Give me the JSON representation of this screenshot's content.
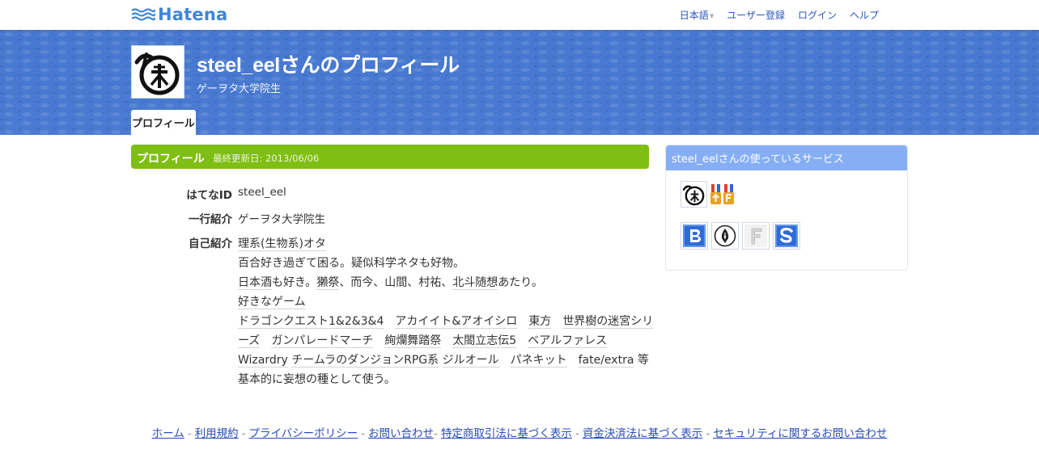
{
  "header": {
    "logo_text": "Hatena",
    "nav": {
      "language": "日本語",
      "register": "ユーザー登録",
      "login": "ログイン",
      "help": "ヘルプ"
    }
  },
  "profile": {
    "title": "steel_eelさんのプロフィール",
    "subtitle": "ゲーヲタ大学院生",
    "tab": "プロフィール"
  },
  "section": {
    "title": "プロフィール",
    "updated": "最終更新日: 2013/06/06"
  },
  "fields": {
    "id_label": "はてなID",
    "id_value": "steel_eel",
    "oneline_label": "一行紹介",
    "oneline_value": "ゲーヲタ大学院生",
    "intro_label": "自己紹介"
  },
  "intro": {
    "l1": "理系(生物系)オタ",
    "l2": "百合好き過ぎて困る。疑似科学ネタも好物。",
    "l3a": "日本酒",
    "l3b": "も好き。",
    "l3c": "獺祭",
    "l3d": "、而今、山間、村祐、",
    "l3e": "北斗随想",
    "l3f": "あたり。",
    "l4": "好きなゲーム",
    "games": {
      "dq": "ドラゴンクエスト1&2&3&4",
      "ac": "アカイイト&アオイシロ",
      "th": "東方",
      "eo1": "世界樹の迷宮シリ",
      "eo2": "ーズ",
      "gpm": "ガンパレードマーチ",
      "kr": "絢爛舞踏祭",
      "tk": "太閤立志伝5",
      "bf": "ベアルファレス",
      "wiz": "Wizardry",
      "chm": "チームラのダンジョンRPG系",
      "jo": "ジルオール",
      "pk": "パネキット",
      "fe": "fate/extra",
      "etc": " 等"
    },
    "l8": "基本的に妄想の種として使う。"
  },
  "side": {
    "title": "steel_eelさんの使っているサービス"
  },
  "footer": {
    "home": "ホーム",
    "terms": "利用規約",
    "privacy": "プライバシーポリシー",
    "contact": "お問い合わせ",
    "tokutei": "特定商取引法に基づく表示",
    "shikin": "資金決済法に基づく表示",
    "security": "セキュリティに関するお問い合わせ"
  },
  "colors": {
    "band": "#4a78cf",
    "section_green": "#7fbe13",
    "side_header": "#86aef5",
    "link": "#2a4cb8"
  }
}
